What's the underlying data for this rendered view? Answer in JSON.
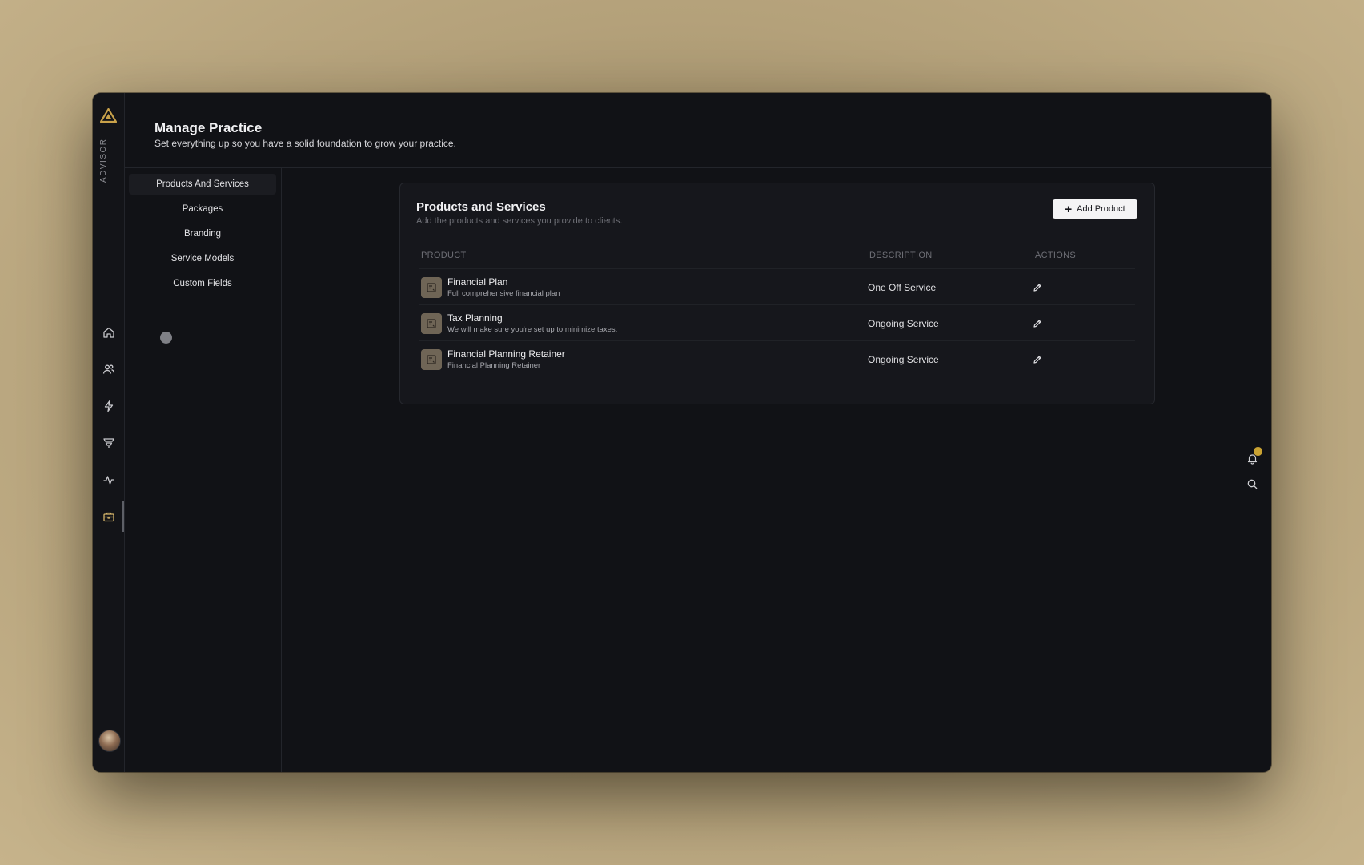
{
  "rail": {
    "brand_label": "ADVISOR",
    "icons": [
      "home-icon",
      "users-icon",
      "bolt-icon",
      "filter-icon",
      "activity-icon",
      "briefcase-icon"
    ],
    "active_icon": "briefcase-icon"
  },
  "header": {
    "title": "Manage Practice",
    "subtitle": "Set everything up so you have a solid foundation to grow your practice."
  },
  "settings_nav": {
    "items": [
      {
        "label": "Products And Services",
        "active": true
      },
      {
        "label": "Packages",
        "active": false
      },
      {
        "label": "Branding",
        "active": false
      },
      {
        "label": "Service Models",
        "active": false
      },
      {
        "label": "Custom Fields",
        "active": false
      }
    ]
  },
  "card": {
    "title": "Products and Services",
    "subtitle": "Add the products and services you provide to clients.",
    "add_button_label": "Add Product"
  },
  "table": {
    "headers": {
      "product": "PRODUCT",
      "description": "DESCRIPTION",
      "actions": "ACTIONS"
    },
    "rows": [
      {
        "name": "Financial Plan",
        "subtitle": "Full comprehensive financial plan",
        "description": "One Off Service"
      },
      {
        "name": "Tax Planning",
        "subtitle": "We will make sure you're set up to minimize taxes.",
        "description": "Ongoing Service"
      },
      {
        "name": "Financial Planning Retainer",
        "subtitle": "Financial Planning Retainer",
        "description": "Ongoing Service"
      }
    ]
  },
  "colors": {
    "window_bg": "#111216",
    "card_bg": "#16171c",
    "accent_gold": "#c9a232",
    "product_icon_bg": "#6f6556",
    "button_bg": "#f4f4f5"
  }
}
